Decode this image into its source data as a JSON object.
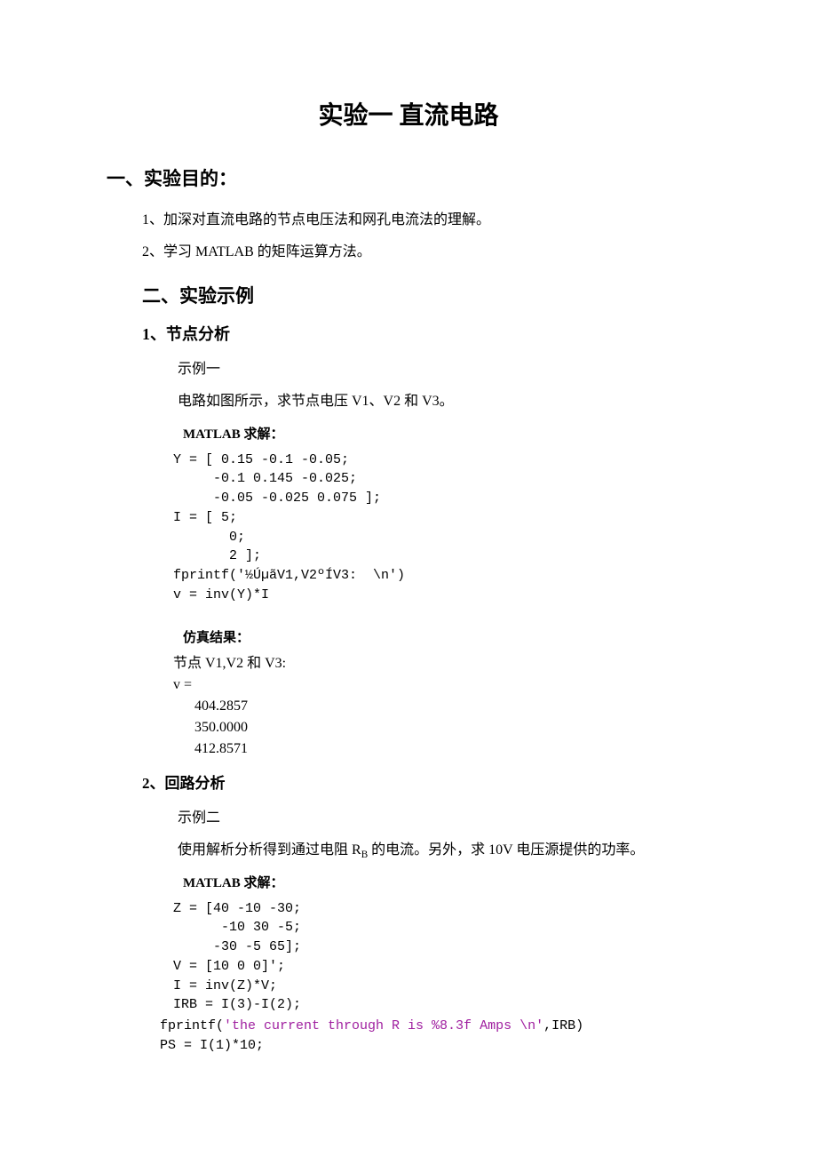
{
  "title": "实验一 直流电路",
  "s1": {
    "heading": "一、实验目的：",
    "p1": "1、加深对直流电路的节点电压法和网孔电流法的理解。",
    "p2": "2、学习 MATLAB 的矩阵运算方法。"
  },
  "s2": {
    "heading": "二、实验示例",
    "sub1": {
      "heading": "1、节点分析",
      "ex": "示例一",
      "desc": "电路如图所示，求节点电压 V1、V2 和 V3。",
      "solve_label": "MATLAB 求解：",
      "code": "Y = [ 0.15 -0.1 -0.05;\n     -0.1 0.145 -0.025;\n     -0.05 -0.025 0.075 ];\nI = [ 5;\n       0;\n       2 ];\nfprintf('½ÚµãV1,V2ºÍV3:  \\n')\nv = inv(Y)*I",
      "result_label": "仿真结果：",
      "result": "节点 V1,V2 和 V3:\nv =\n      404.2857\n      350.0000\n      412.8571"
    },
    "sub2": {
      "heading": "2、回路分析",
      "ex": "示例二",
      "desc_pre": "使用解析分析得到通过电阻 R",
      "desc_sub": "B",
      "desc_post": " 的电流。另外，求 10V 电压源提供的功率。",
      "solve_label": "MATLAB 求解：",
      "code_l1": "Z = [40 -10 -30;",
      "code_l2": "      -10 30 -5;",
      "code_l3": "     -30 -5 65];",
      "code_l4": "V = [10 0 0]';",
      "code_l5": "I = inv(Z)*V;",
      "code_l6": "IRB = I(3)-I(2);",
      "code_l7a": "fprintf(",
      "code_l7b": "'the current through R is %8.3f Amps \\n'",
      "code_l7c": ",IRB)",
      "code_l8": "PS = I(1)*10;"
    }
  }
}
